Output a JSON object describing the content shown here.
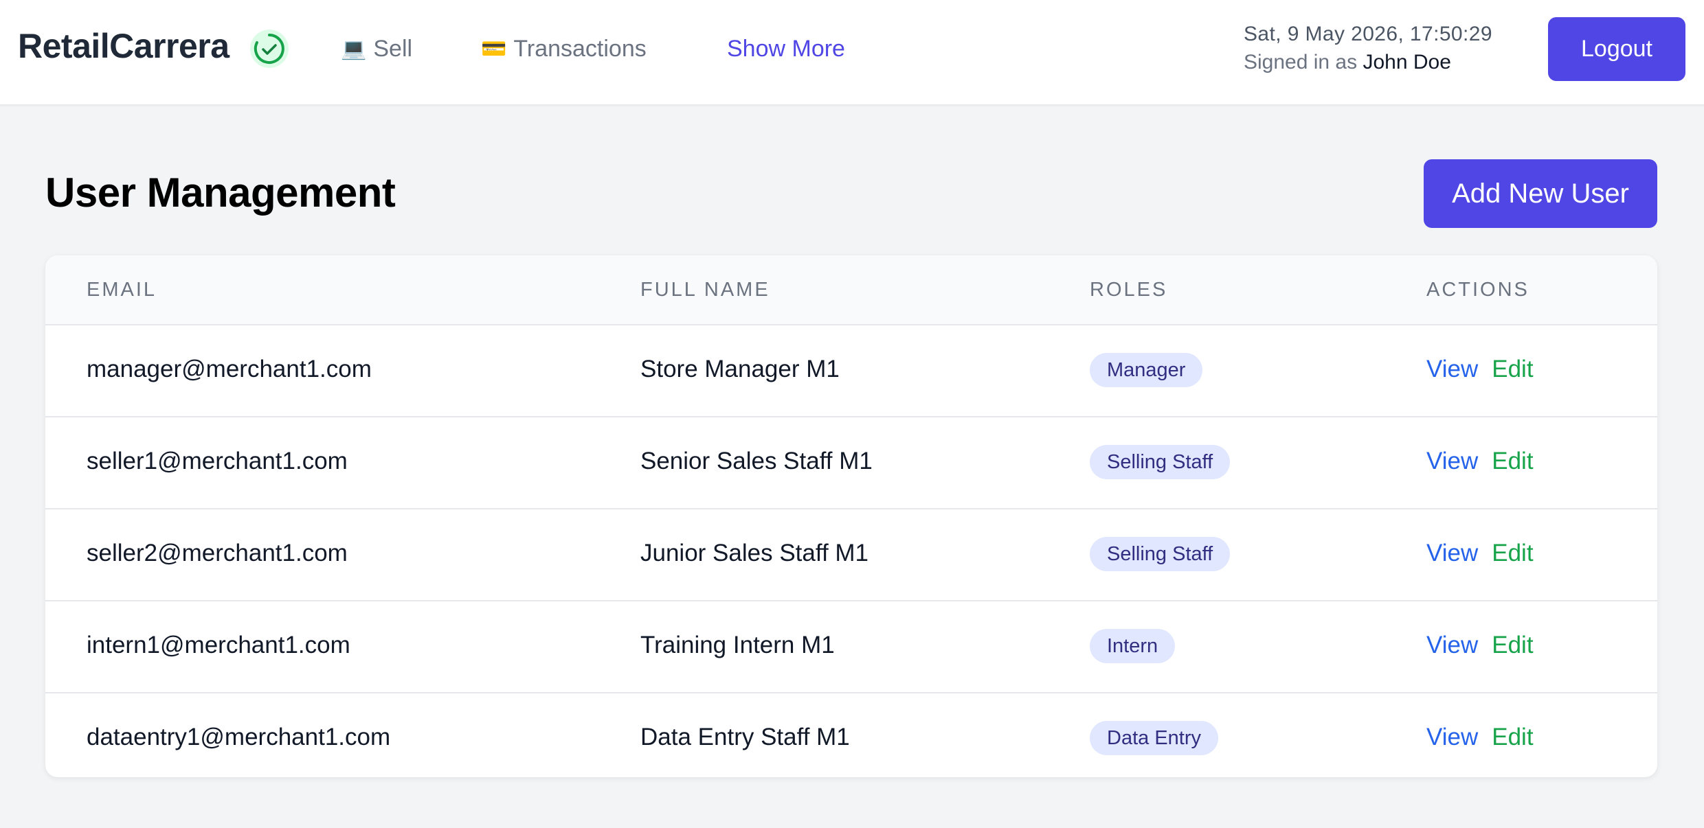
{
  "header": {
    "brand": "RetailCarrera",
    "sync_icon": "check-circle-icon",
    "nav": [
      {
        "icon": "💻",
        "label": "Sell"
      },
      {
        "icon": "💳",
        "label": "Transactions"
      },
      {
        "label": "Show More"
      }
    ],
    "datetime": "Sat, 9 May 2026, 17:50:29",
    "signed_in_prefix": "Signed in as",
    "user_name": "John Doe",
    "logout_label": "Logout"
  },
  "page": {
    "title": "User Management",
    "add_user_label": "Add New User"
  },
  "table": {
    "columns": [
      "EMAIL",
      "FULL NAME",
      "ROLES",
      "ACTIONS"
    ],
    "rows": [
      {
        "email": "manager@merchant1.com",
        "name": "Store Manager M1",
        "role": "Manager",
        "view": "View",
        "edit": "Edit"
      },
      {
        "email": "seller1@merchant1.com",
        "name": "Senior Sales Staff M1",
        "role": "Selling Staff",
        "view": "View",
        "edit": "Edit"
      },
      {
        "email": "seller2@merchant1.com",
        "name": "Junior Sales Staff M1",
        "role": "Selling Staff",
        "view": "View",
        "edit": "Edit"
      },
      {
        "email": "intern1@merchant1.com",
        "name": "Training Intern M1",
        "role": "Intern",
        "view": "View",
        "edit": "Edit"
      },
      {
        "email": "dataentry1@merchant1.com",
        "name": "Data Entry Staff M1",
        "role": "Data Entry",
        "view": "View",
        "edit": "Edit"
      }
    ]
  },
  "colors": {
    "accent": "#4f46e5",
    "badge_bg": "#e0e7ff",
    "view_link": "#2563eb",
    "edit_link": "#16a34a",
    "sync_ok": "#16a34a"
  }
}
